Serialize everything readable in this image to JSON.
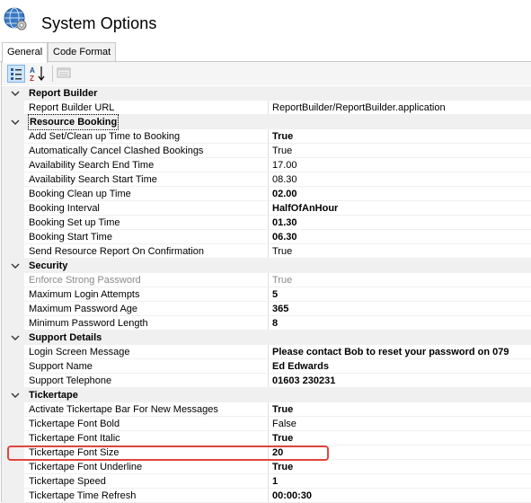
{
  "window": {
    "title": "System Options"
  },
  "tabs": [
    {
      "label": "General",
      "active": true
    },
    {
      "label": "Code Format",
      "active": false
    }
  ],
  "toolbar": {
    "icons": [
      "categorized-icon",
      "alphabetical-sort-icon",
      "property-pages-icon"
    ]
  },
  "categories": [
    {
      "name": "Report Builder",
      "properties": [
        {
          "name": "Report Builder URL",
          "value": "ReportBuilder/ReportBuilder.application",
          "bold": false,
          "disabled": false
        }
      ]
    },
    {
      "name": "Resource Booking",
      "properties": [
        {
          "name": "Add Set/Clean up Time to Booking",
          "value": "True",
          "bold": true,
          "disabled": false
        },
        {
          "name": "Automatically Cancel Clashed Bookings",
          "value": "True",
          "bold": false,
          "disabled": false
        },
        {
          "name": "Availability Search End Time",
          "value": "17.00",
          "bold": false,
          "disabled": false
        },
        {
          "name": "Availability Search Start Time",
          "value": "08.30",
          "bold": false,
          "disabled": false
        },
        {
          "name": "Booking Clean up Time",
          "value": "02.00",
          "bold": true,
          "disabled": false
        },
        {
          "name": "Booking Interval",
          "value": "HalfOfAnHour",
          "bold": true,
          "disabled": false
        },
        {
          "name": "Booking Set up Time",
          "value": "01.30",
          "bold": true,
          "disabled": false
        },
        {
          "name": "Booking Start Time",
          "value": "06.30",
          "bold": true,
          "disabled": false
        },
        {
          "name": "Send Resource Report On Confirmation",
          "value": "True",
          "bold": false,
          "disabled": false
        }
      ]
    },
    {
      "name": "Security",
      "properties": [
        {
          "name": "Enforce Strong Password",
          "value": "True",
          "bold": false,
          "disabled": true
        },
        {
          "name": "Maximum Login Attempts",
          "value": "5",
          "bold": true,
          "disabled": false
        },
        {
          "name": "Maximum Password Age",
          "value": "365",
          "bold": true,
          "disabled": false
        },
        {
          "name": "Minimum Password Length",
          "value": "8",
          "bold": true,
          "disabled": false
        }
      ]
    },
    {
      "name": "Support Details",
      "properties": [
        {
          "name": "Login Screen Message",
          "value": "Please contact Bob to reset your password on 079",
          "bold": true,
          "disabled": false
        },
        {
          "name": "Support Name",
          "value": "Ed Edwards",
          "bold": true,
          "disabled": false
        },
        {
          "name": "Support Telephone",
          "value": "01603 230231",
          "bold": true,
          "disabled": false
        }
      ]
    },
    {
      "name": "Tickertape",
      "properties": [
        {
          "name": "Activate Tickertape Bar For New Messages",
          "value": "True",
          "bold": true,
          "disabled": false
        },
        {
          "name": "Tickertape Font Bold",
          "value": "False",
          "bold": false,
          "disabled": false
        },
        {
          "name": "Tickertape Font Italic",
          "value": "True",
          "bold": true,
          "disabled": false
        },
        {
          "name": "Tickertape Font Size",
          "value": "20",
          "bold": true,
          "disabled": false
        },
        {
          "name": "Tickertape Font Underline",
          "value": "True",
          "bold": true,
          "disabled": false
        },
        {
          "name": "Tickertape Speed",
          "value": "1",
          "bold": true,
          "disabled": false
        },
        {
          "name": "Tickertape Time Refresh",
          "value": "00:00:30",
          "bold": true,
          "disabled": false
        }
      ]
    }
  ],
  "highlighted_property": "Tickertape Font Size",
  "colors": {
    "highlight": "#e0463a",
    "category_bg": "#f0f0f0",
    "disabled_text": "#8a8a8a"
  }
}
